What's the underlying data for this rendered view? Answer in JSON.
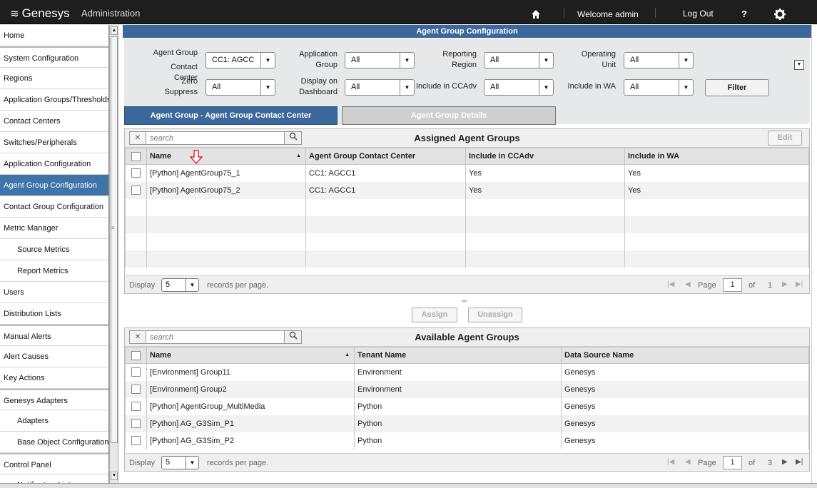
{
  "topbar": {
    "logo": "Genesys",
    "section": "Administration",
    "welcome": "Welcome  admin",
    "logout": "Log Out",
    "help": "?"
  },
  "sidebar": {
    "items": [
      {
        "label": "Home"
      },
      {
        "label": "System Configuration"
      },
      {
        "label": "Regions"
      },
      {
        "label": "Application Groups/Thresholds"
      },
      {
        "label": "Contact Centers"
      },
      {
        "label": "Switches/Peripherals"
      },
      {
        "label": "Application Configuration"
      },
      {
        "label": "Agent Group Configuration",
        "active": true
      },
      {
        "label": "Contact Group Configuration"
      },
      {
        "label": "Metric Manager"
      },
      {
        "label": "Source Metrics",
        "sub": true
      },
      {
        "label": "Report Metrics",
        "sub": true
      },
      {
        "label": "Users"
      },
      {
        "label": "Distribution Lists"
      },
      {
        "label": "Manual Alerts"
      },
      {
        "label": "Alert Causes"
      },
      {
        "label": "Key Actions"
      },
      {
        "label": "Genesys Adapters"
      },
      {
        "label": "Adapters",
        "sub": true
      },
      {
        "label": "Base Object Configuration",
        "sub": true
      },
      {
        "label": "Control Panel"
      },
      {
        "label": "Notification Lists",
        "sub": true
      }
    ]
  },
  "page_title": "Agent Group Configuration",
  "filters": {
    "agent_group_contact_center": {
      "label1": "Agent Group",
      "label2": "Contact Center",
      "value": "CC1: AGCC"
    },
    "application_group": {
      "label1": "Application",
      "label2": "Group",
      "value": "All"
    },
    "reporting_region": {
      "label1": "Reporting",
      "label2": "Region",
      "value": "All"
    },
    "operating_unit": {
      "label1": "Operating",
      "label2": "Unit",
      "value": "All"
    },
    "zero_suppress": {
      "label1": "Zero",
      "label2": "Suppress",
      "value": "All"
    },
    "display_on_dashboard": {
      "label1": "Display on",
      "label2": "Dashboard",
      "value": "All"
    },
    "include_ccadv": {
      "label": "Include in CCAdv",
      "value": "All"
    },
    "include_wa": {
      "label": "Include in WA",
      "value": "All"
    },
    "filter_button": "Filter"
  },
  "tabs": {
    "active": "Agent Group - Agent Group Contact Center",
    "inactive": "Agent Group Details"
  },
  "assigned": {
    "title": "Assigned Agent Groups",
    "search_placeholder": "search",
    "edit": "Edit",
    "columns": [
      "Name",
      "Agent Group Contact Center",
      "Include in CCAdv",
      "Include in WA"
    ],
    "rows": [
      [
        "[Python] AgentGroup75_1",
        "CC1: AGCC1",
        "Yes",
        "Yes"
      ],
      [
        "[Python] AgentGroup75_2",
        "CC1: AGCC1",
        "Yes",
        "Yes"
      ]
    ],
    "pager": {
      "display": "Display",
      "per_page_value": "5",
      "records": "records per page.",
      "page": "Page",
      "current": "1",
      "of": "of",
      "total": "1"
    }
  },
  "actions": {
    "assign": "Assign",
    "unassign": "Unassign"
  },
  "available": {
    "title": "Available Agent Groups",
    "search_placeholder": "search",
    "columns": [
      "Name",
      "Tenant Name",
      "Data Source Name"
    ],
    "rows": [
      [
        "[Environment] Group11",
        "Environment",
        "Genesys"
      ],
      [
        "[Environment] Group2",
        "Environment",
        "Genesys"
      ],
      [
        "[Python] AgentGroup_MultiMedia",
        "Python",
        "Genesys"
      ],
      [
        "[Python] AG_G3Sim_P1",
        "Python",
        "Genesys"
      ],
      [
        "[Python] AG_G3Sim_P2",
        "Python",
        "Genesys"
      ]
    ],
    "pager": {
      "display": "Display",
      "per_page_value": "5",
      "records": "records per page.",
      "page": "Page",
      "current": "1",
      "of": "of",
      "total": "3"
    }
  },
  "colors": {
    "accent": "#3c679a",
    "active_nav": "#3f74a8",
    "topbar": "#1e1e1e"
  }
}
